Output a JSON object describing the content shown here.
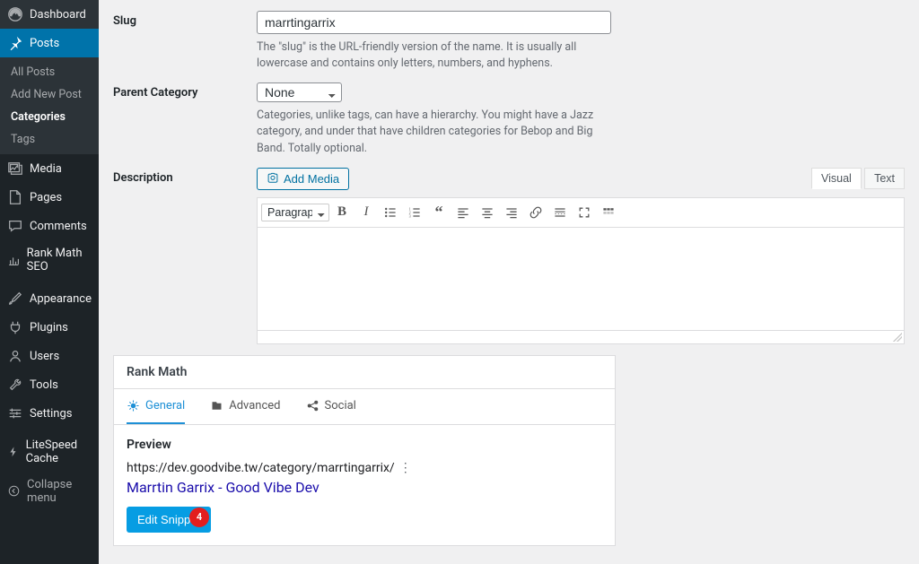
{
  "sidebar": {
    "dashboard": "Dashboard",
    "posts": "Posts",
    "sub": {
      "all": "All Posts",
      "add": "Add New Post",
      "cat": "Categories",
      "tags": "Tags"
    },
    "media": "Media",
    "pages": "Pages",
    "comments": "Comments",
    "rankmath": "Rank Math SEO",
    "appearance": "Appearance",
    "plugins": "Plugins",
    "users": "Users",
    "tools": "Tools",
    "settings": "Settings",
    "litespeed": "LiteSpeed Cache",
    "collapse": "Collapse menu"
  },
  "form": {
    "slug": {
      "label": "Slug",
      "value": "marrtingarrix",
      "help": "The \"slug\" is the URL-friendly version of the name. It is usually all lowercase and contains only letters, numbers, and hyphens."
    },
    "parent": {
      "label": "Parent Category",
      "value": "None",
      "help": "Categories, unlike tags, can have a hierarchy. You might have a Jazz category, and under that have children categories for Bebop and Big Band. Totally optional."
    },
    "desc": {
      "label": "Description",
      "addmedia": "Add Media",
      "visual": "Visual",
      "text": "Text",
      "paragraph": "Paragraph"
    }
  },
  "rm": {
    "title": "Rank Math",
    "tabs": {
      "general": "General",
      "advanced": "Advanced",
      "social": "Social"
    },
    "preview": "Preview",
    "serp_url": "https://dev.goodvibe.tw/category/marrtingarrix/",
    "serp_title": "Marrtin Garrix - Good Vibe Dev",
    "edit": "Edit Snippet",
    "badge": "4"
  }
}
